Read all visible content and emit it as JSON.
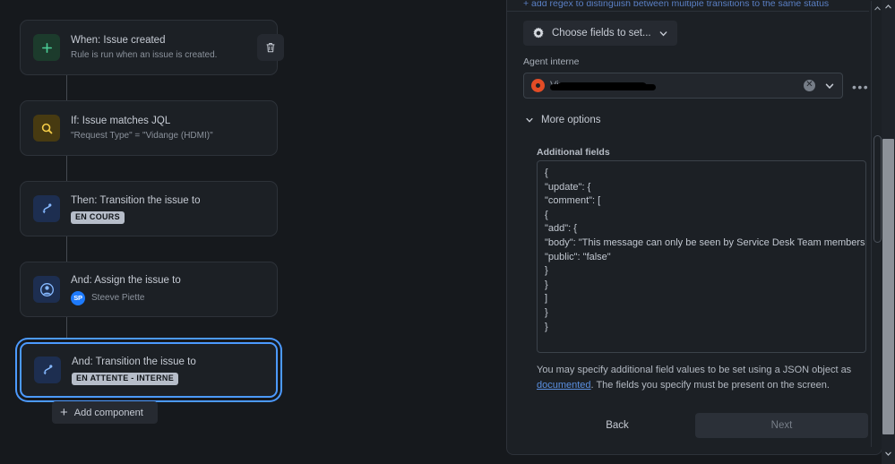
{
  "canvas": {
    "trash_icon": "trash-icon",
    "add_component_label": "Add component",
    "nodes": [
      {
        "icon": "plus-icon",
        "title": "When: Issue created",
        "subtitle": "Rule is run when an issue is created.",
        "selected": false
      },
      {
        "icon": "magnifier-icon",
        "title": "If: Issue matches JQL",
        "subtitle": "\"Request Type\" = \"Vidange (HDMI)\"",
        "selected": false
      },
      {
        "icon": "transition-icon",
        "title": "Then: Transition the issue to",
        "lozenge": "EN COURS",
        "selected": false
      },
      {
        "icon": "person-icon",
        "title": "And: Assign the issue to",
        "assignee_initials": "SP",
        "assignee_name": "Steeve Piette",
        "selected": false
      },
      {
        "icon": "transition-icon",
        "title": "And: Transition the issue to",
        "lozenge": "EN ATTENTE - INTERNE",
        "selected": true
      }
    ]
  },
  "panel": {
    "regex_link": "+ add regex to distinguish between multiple transitions to the same status",
    "choose_fields": {
      "icon": "gear-icon",
      "label": "Choose fields to set...",
      "chevron": "chevron-down-icon"
    },
    "agent_field": {
      "label": "Agent interne",
      "value_ghost": "Vir",
      "clear_icon": "clear-circle-icon",
      "chevron": "chevron-down-icon",
      "overflow_icon": "more-dots-icon"
    },
    "more_options": {
      "chevron": "chevron-down-icon",
      "label": "More options"
    },
    "additional_fields": {
      "label": "Additional fields",
      "json_lines": [
        "{",
        "\"update\": {",
        "\"comment\": [",
        "{",
        "\"add\": {",
        "\"body\": \"This message can only be seen by Service Desk Team members\",",
        "\"public\": \"false\"",
        "}",
        "}",
        "]",
        "}",
        "}"
      ]
    },
    "help_text": {
      "before": "You may specify additional field values to be set using a JSON object as ",
      "link": "documented",
      "after": ". The fields you specify must be present on the screen."
    },
    "buttons": {
      "back": "Back",
      "next": "Next"
    }
  },
  "colors": {
    "accent_blue": "#4c9aff",
    "link_blue": "#5a8fe0",
    "panel_bg": "#1c2025",
    "canvas_bg": "#16191d",
    "lozenge_bg": "#b6bdc9",
    "avatar_blue": "#1d7afc",
    "avatar_orange": "#e24c26"
  },
  "scrollbars": {
    "inner_up_arrow": "chevron-up-icon",
    "outer_up_arrow": "chevron-up-icon",
    "outer_down_arrow": "chevron-down-icon"
  }
}
